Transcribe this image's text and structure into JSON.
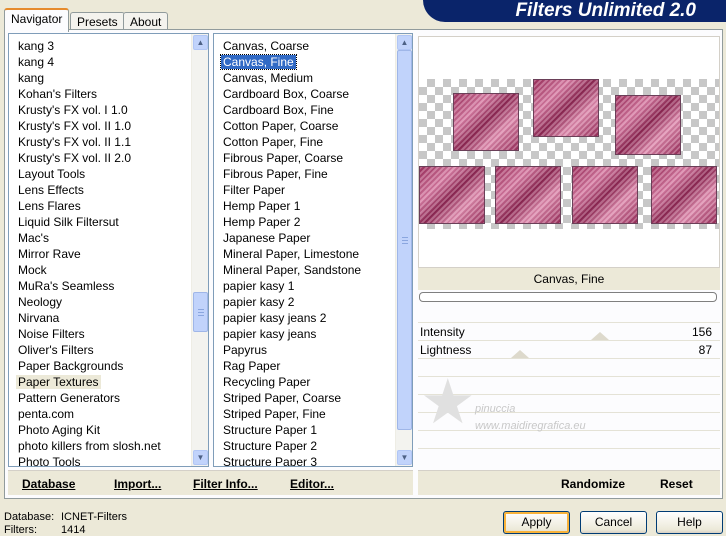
{
  "tabs": [
    "Navigator",
    "Presets",
    "About"
  ],
  "banner_title": "Filters Unlimited 2.0",
  "categories": [
    "kang 3",
    "kang 4",
    "kang",
    "Kohan's Filters",
    "Krusty's FX vol. I 1.0",
    "Krusty's FX vol. II 1.0",
    "Krusty's FX vol. II 1.1",
    "Krusty's FX vol. II 2.0",
    "Layout Tools",
    "Lens Effects",
    "Lens Flares",
    "Liquid Silk Filtersut",
    "Mac's",
    "Mirror Rave",
    "Mock",
    "MuRa's Seamless",
    "Neology",
    "Nirvana",
    "Noise Filters",
    "Oliver's Filters",
    "Paper Backgrounds",
    "Paper Textures",
    "Pattern Generators",
    "penta.com",
    "Photo Aging Kit",
    "photo killers from slosh.net",
    "Photo Tools"
  ],
  "selected_category": "Paper Textures",
  "filters": [
    "Canvas, Coarse",
    "Canvas, Fine",
    "Canvas, Medium",
    "Cardboard Box, Coarse",
    "Cardboard Box, Fine",
    "Cotton Paper, Coarse",
    "Cotton Paper, Fine",
    "Fibrous Paper, Coarse",
    "Fibrous Paper, Fine",
    "Filter Paper",
    "Hemp Paper 1",
    "Hemp Paper 2",
    "Japanese Paper",
    "Mineral Paper, Limestone",
    "Mineral Paper, Sandstone",
    "papier kasy 1",
    "papier kasy 2",
    "papier kasy jeans 2",
    "papier kasy jeans",
    "Papyrus",
    "Rag Paper",
    "Recycling Paper",
    "Striped Paper, Coarse",
    "Striped Paper, Fine",
    "Structure Paper 1",
    "Structure Paper 2",
    "Structure Paper 3"
  ],
  "selected_filter": "Canvas, Fine",
  "links": {
    "database": "Database",
    "import": "Import...",
    "filter_info": "Filter Info...",
    "editor": "Editor..."
  },
  "preview": {
    "filter_name": "Canvas, Fine"
  },
  "params": [
    {
      "name": "Intensity",
      "value": "156"
    },
    {
      "name": "Lightness",
      "value": "87"
    }
  ],
  "watermark": {
    "line1": "pinuccia",
    "line2": "www.maidiregrafica.eu"
  },
  "actions": {
    "randomize": "Randomize",
    "reset": "Reset"
  },
  "footer": {
    "database_label": "Database:",
    "database_value": "ICNET-Filters",
    "filters_label": "Filters:",
    "filters_value": "1414"
  },
  "buttons": {
    "apply": "Apply",
    "cancel": "Cancel",
    "help": "Help"
  }
}
